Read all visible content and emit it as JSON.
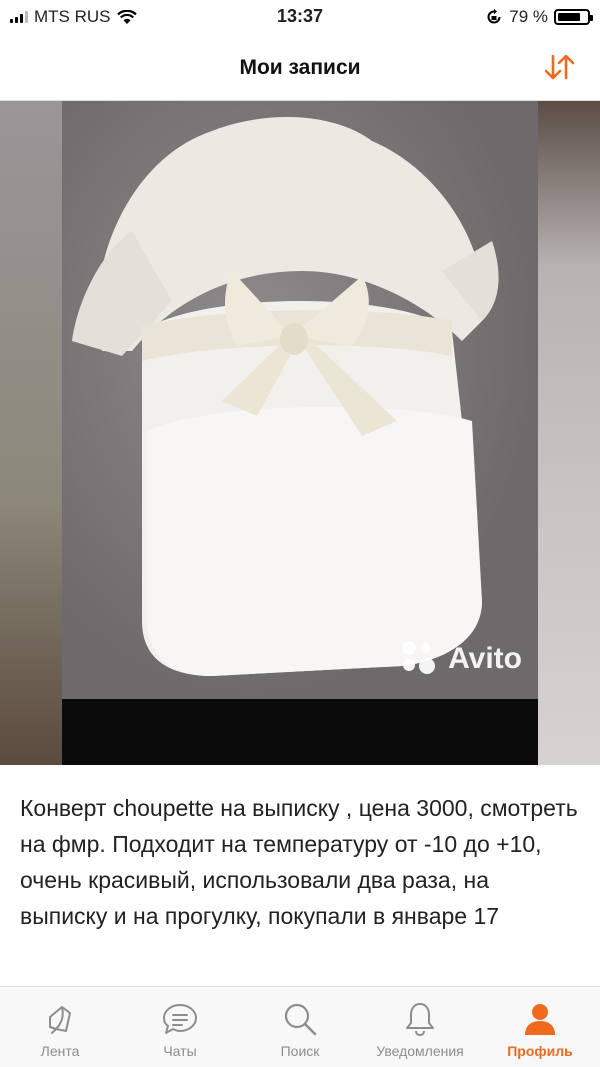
{
  "status_bar": {
    "carrier": "MTS RUS",
    "time": "13:37",
    "battery_percent_label": "79 %",
    "battery_level": 0.79
  },
  "navbar": {
    "title": "Мои записи",
    "sort_icon": "sort-arrows-icon"
  },
  "post": {
    "image_watermark": "Avito",
    "description": "Конверт choupette на выписку , цена 3000, смотреть на фмр. Подходит на температуру от -10 до +10, очень красивый, использовали два раза, на выписку и на прогулку, покупали в январе 17"
  },
  "tabbar": {
    "tabs": [
      {
        "label": "Лента",
        "icon": "feed-icon",
        "active": false
      },
      {
        "label": "Чаты",
        "icon": "chat-icon",
        "active": false
      },
      {
        "label": "Поиск",
        "icon": "search-icon",
        "active": false
      },
      {
        "label": "Уведомления",
        "icon": "bell-icon",
        "active": false
      },
      {
        "label": "Профиль",
        "icon": "profile-icon",
        "active": true
      }
    ]
  },
  "colors": {
    "accent": "#f06a1e",
    "inactive": "#8d8d8d"
  }
}
